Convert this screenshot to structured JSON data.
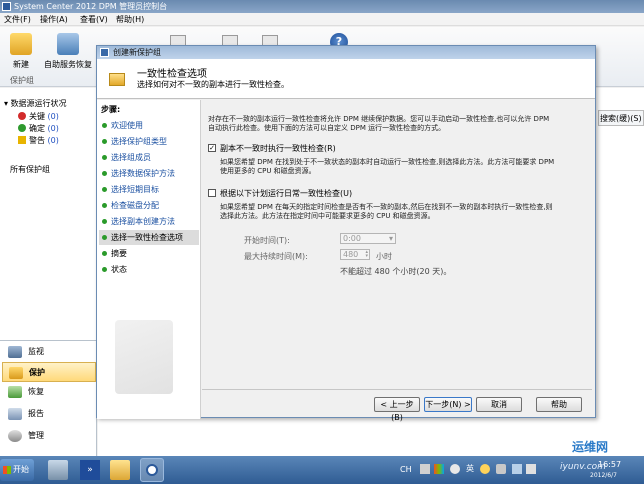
{
  "app": {
    "title": "System Center 2012 DPM 管理员控制台",
    "menus": [
      "文件(F)",
      "操作(A)",
      "查看(V)",
      "帮助(H)"
    ],
    "ribbon": {
      "new_label": "新建",
      "auto_recovery_label": "自助服务恢复",
      "group_label": "保护组"
    },
    "sidebar": {
      "status_header": "数据源运行状况",
      "status": [
        {
          "label": "关键",
          "count": "(0)",
          "color": "#d22b2b"
        },
        {
          "label": "确定",
          "count": "(0)",
          "color": "#2e9a2e"
        },
        {
          "label": "警告",
          "count": "(0)",
          "color": "#e8b400"
        }
      ],
      "all_groups": "所有保护组",
      "nav": [
        "监视",
        "保护",
        "恢复",
        "报告",
        "管理"
      ]
    },
    "right_fragment": "搜索(缓)(S)"
  },
  "dialog": {
    "title": "创建新保护组",
    "heading": "一致性检查选项",
    "subheading": "选择如何对不一致的副本进行一致性检查。",
    "steps_header": "步骤:",
    "steps": [
      "欢迎使用",
      "选择保护组类型",
      "选择组成员",
      "选择数据保护方法",
      "选择短期目标",
      "检查磁盘分配",
      "选择副本创建方法",
      "选择一致性检查选项",
      "摘要",
      "状态"
    ],
    "intro": [
      "对存在不一致的副本运行一致性检查将允许 DPM 继续保护数据。您可以手动启动一致性检查,也可以允许 DPM",
      "自动执行此检查。使用下面的方法可以自定义 DPM 运行一致性检查的方式。"
    ],
    "option1": {
      "label": "副本不一致时执行一致性检查(R)",
      "checked": true,
      "desc": [
        "如果您希望 DPM 在找到处于不一致状态的副本时自动运行一致性检查,则选择此方法。此方法可能要求 DPM",
        "使用更多的 CPU 和磁盘资源。"
      ]
    },
    "option2": {
      "label": "根据以下计划运行日常一致性检查(U)",
      "checked": false,
      "desc": [
        "如果您希望 DPM 在每天的指定时间检查是否有不一致的副本,然后在找到不一致的副本时执行一致性检查,则",
        "选择此方法。此方法在指定时间中可能要求更多的 CPU 和磁盘资源。"
      ]
    },
    "start_time_label": "开始时间(T):",
    "start_time_value": "0:00",
    "max_duration_label": "最大持续时间(M):",
    "max_duration_value": "480",
    "max_duration_unit": "小时",
    "limit_note": "不能超过 480 个小时(20 天)。",
    "buttons": {
      "back": "< 上一步(B)",
      "next": "下一步(N) >",
      "cancel": "取消",
      "help": "帮助"
    }
  },
  "taskbar": {
    "start": "开始",
    "lang": "CH",
    "time": "16:57",
    "date": "2012/6/7",
    "watermark": "运维网",
    "watermark_url": "iyunv.com"
  }
}
